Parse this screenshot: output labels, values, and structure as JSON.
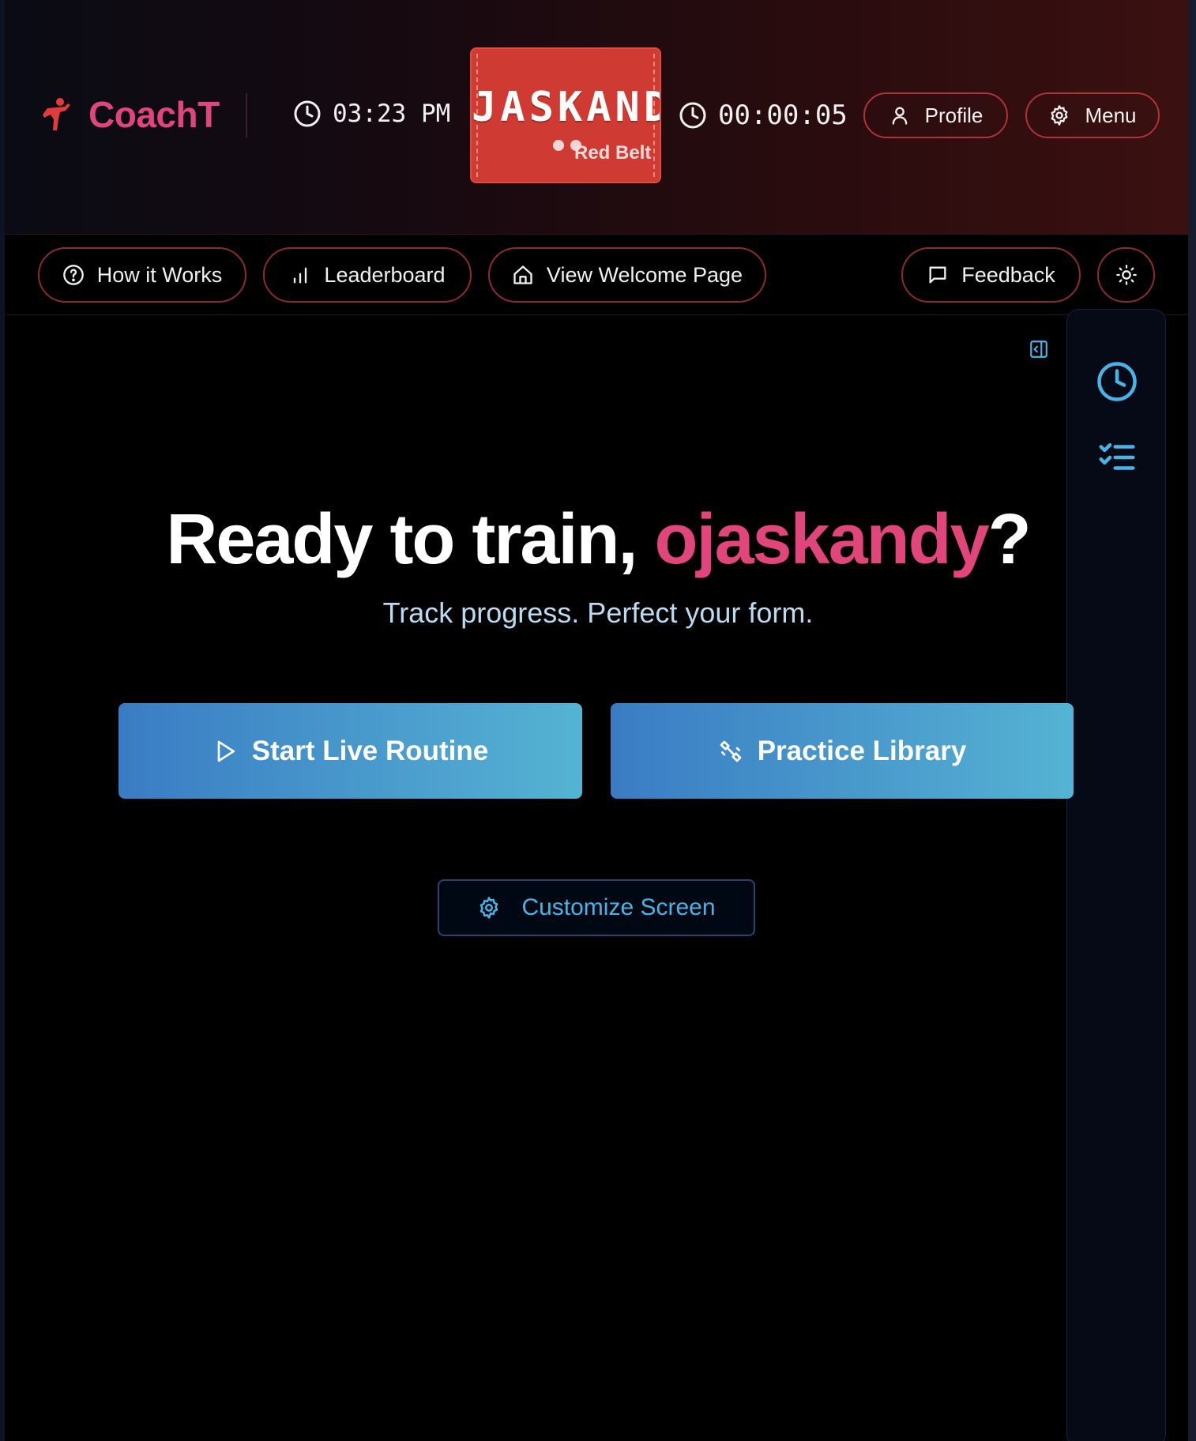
{
  "header": {
    "brand": "CoachT",
    "time": "03:23 PM",
    "belt": {
      "name": "JASKAND",
      "rank": "Red Belt",
      "color": "#cf3a32"
    },
    "timer": "00:00:05",
    "profile_label": "Profile",
    "menu_label": "Menu"
  },
  "nav": {
    "how_it_works": "How it Works",
    "leaderboard": "Leaderboard",
    "welcome": "View Welcome Page",
    "feedback": "Feedback"
  },
  "hero": {
    "greeting": "Ready to train, ",
    "username": "ojaskandy",
    "punct": "?",
    "subtitle": "Track progress. Perfect your form."
  },
  "actions": {
    "start_live": "Start Live Routine",
    "practice_library": "Practice Library",
    "customize": "Customize Screen"
  },
  "colors": {
    "brand_pink": "#e0457b",
    "accent_blue": "#4ab3e6",
    "button_border_red": "#b0323a"
  },
  "icons": [
    "kick-logo-icon",
    "clock-icon",
    "user-icon",
    "gear-icon",
    "help-circle-icon",
    "bar-chart-icon",
    "home-icon",
    "message-icon",
    "sun-icon",
    "collapse-panel-icon",
    "history-clock-icon",
    "checklist-icon",
    "play-icon",
    "practice-icon"
  ]
}
